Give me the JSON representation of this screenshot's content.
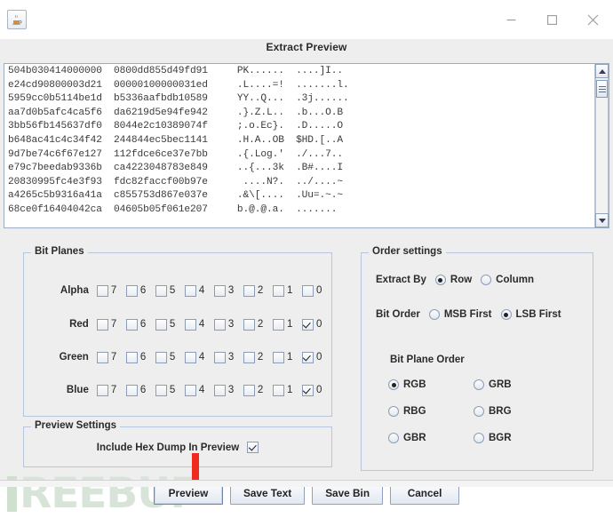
{
  "window": {
    "app_icon": "java-coffee-cup-icon",
    "controls": {
      "minimize": "minimize-icon",
      "maximize": "maximize-icon",
      "close": "close-icon"
    }
  },
  "header": {
    "title": "Extract Preview"
  },
  "hex_dump": {
    "lines": [
      "504b030414000000  0800dd855d49fd91     PK......  ....]I..",
      "e24cd90800003d21  00000100000031ed     .L....=!  .......l.",
      "5959cc0b5114be1d  b5336aafbdb10589     YY..Q...  .3j......",
      "aa7d0b5afc4ca5f6  da6219d5e94fe942     .}.Z.L..  .b...O.B",
      "3bb56fb145637df0  8044e2c10389074f     ;.o.Ec}.  .D.....O",
      "b648ac41c4c34f42  244844ec5bec1141     .H.A..OB  $HD.[..A",
      "9d7be74c6f67e127  112fdce6ce37e7bb     .{.Log.'  ./...7..",
      "e79c7beedab9336b  ca4223048783e849     ..{...3k  .B#....I",
      "20830995fc4e3f93  fdc82faccf00b97e      ....N?.  ../....~",
      "a4265c5b9316a41a  c855753d867e037e     .&\\[....  .Uu=.~.~"
    ],
    "scrollbar": {
      "up_arrow": "scroll-up-icon",
      "down_arrow": "scroll-down-icon"
    }
  },
  "bit_planes": {
    "title": "Bit Planes",
    "bits": [
      "7",
      "6",
      "5",
      "4",
      "3",
      "2",
      "1",
      "0"
    ],
    "rows": [
      {
        "label": "Alpha",
        "checked": [
          false,
          false,
          false,
          false,
          false,
          false,
          false,
          false
        ]
      },
      {
        "label": "Red",
        "checked": [
          false,
          false,
          false,
          false,
          false,
          false,
          false,
          true
        ]
      },
      {
        "label": "Green",
        "checked": [
          false,
          false,
          false,
          false,
          false,
          false,
          false,
          true
        ]
      },
      {
        "label": "Blue",
        "checked": [
          false,
          false,
          false,
          false,
          false,
          false,
          false,
          true
        ]
      }
    ]
  },
  "order_settings": {
    "title": "Order settings",
    "extract_by": {
      "label": "Extract By",
      "options": [
        "Row",
        "Column"
      ],
      "selected": "Row"
    },
    "bit_order": {
      "label": "Bit Order",
      "options": [
        "MSB First",
        "LSB First"
      ],
      "selected": "LSB First"
    },
    "bit_plane_order": {
      "label": "Bit Plane Order",
      "options": [
        "RGB",
        "GRB",
        "RBG",
        "BRG",
        "GBR",
        "BGR"
      ],
      "selected": "RGB"
    }
  },
  "preview_settings": {
    "title": "Preview Settings",
    "include_hex_dump": {
      "label": "Include Hex Dump In Preview",
      "checked": true
    }
  },
  "buttons": [
    {
      "label": "Preview",
      "focused": true
    },
    {
      "label": "Save Text",
      "focused": false
    },
    {
      "label": "Save Bin",
      "focused": false
    },
    {
      "label": "Cancel",
      "focused": false
    }
  ],
  "watermark": {
    "text": "REEBUF"
  },
  "annotation": {
    "arrow_color": "#ee2b1e",
    "points_to": "Preview"
  }
}
